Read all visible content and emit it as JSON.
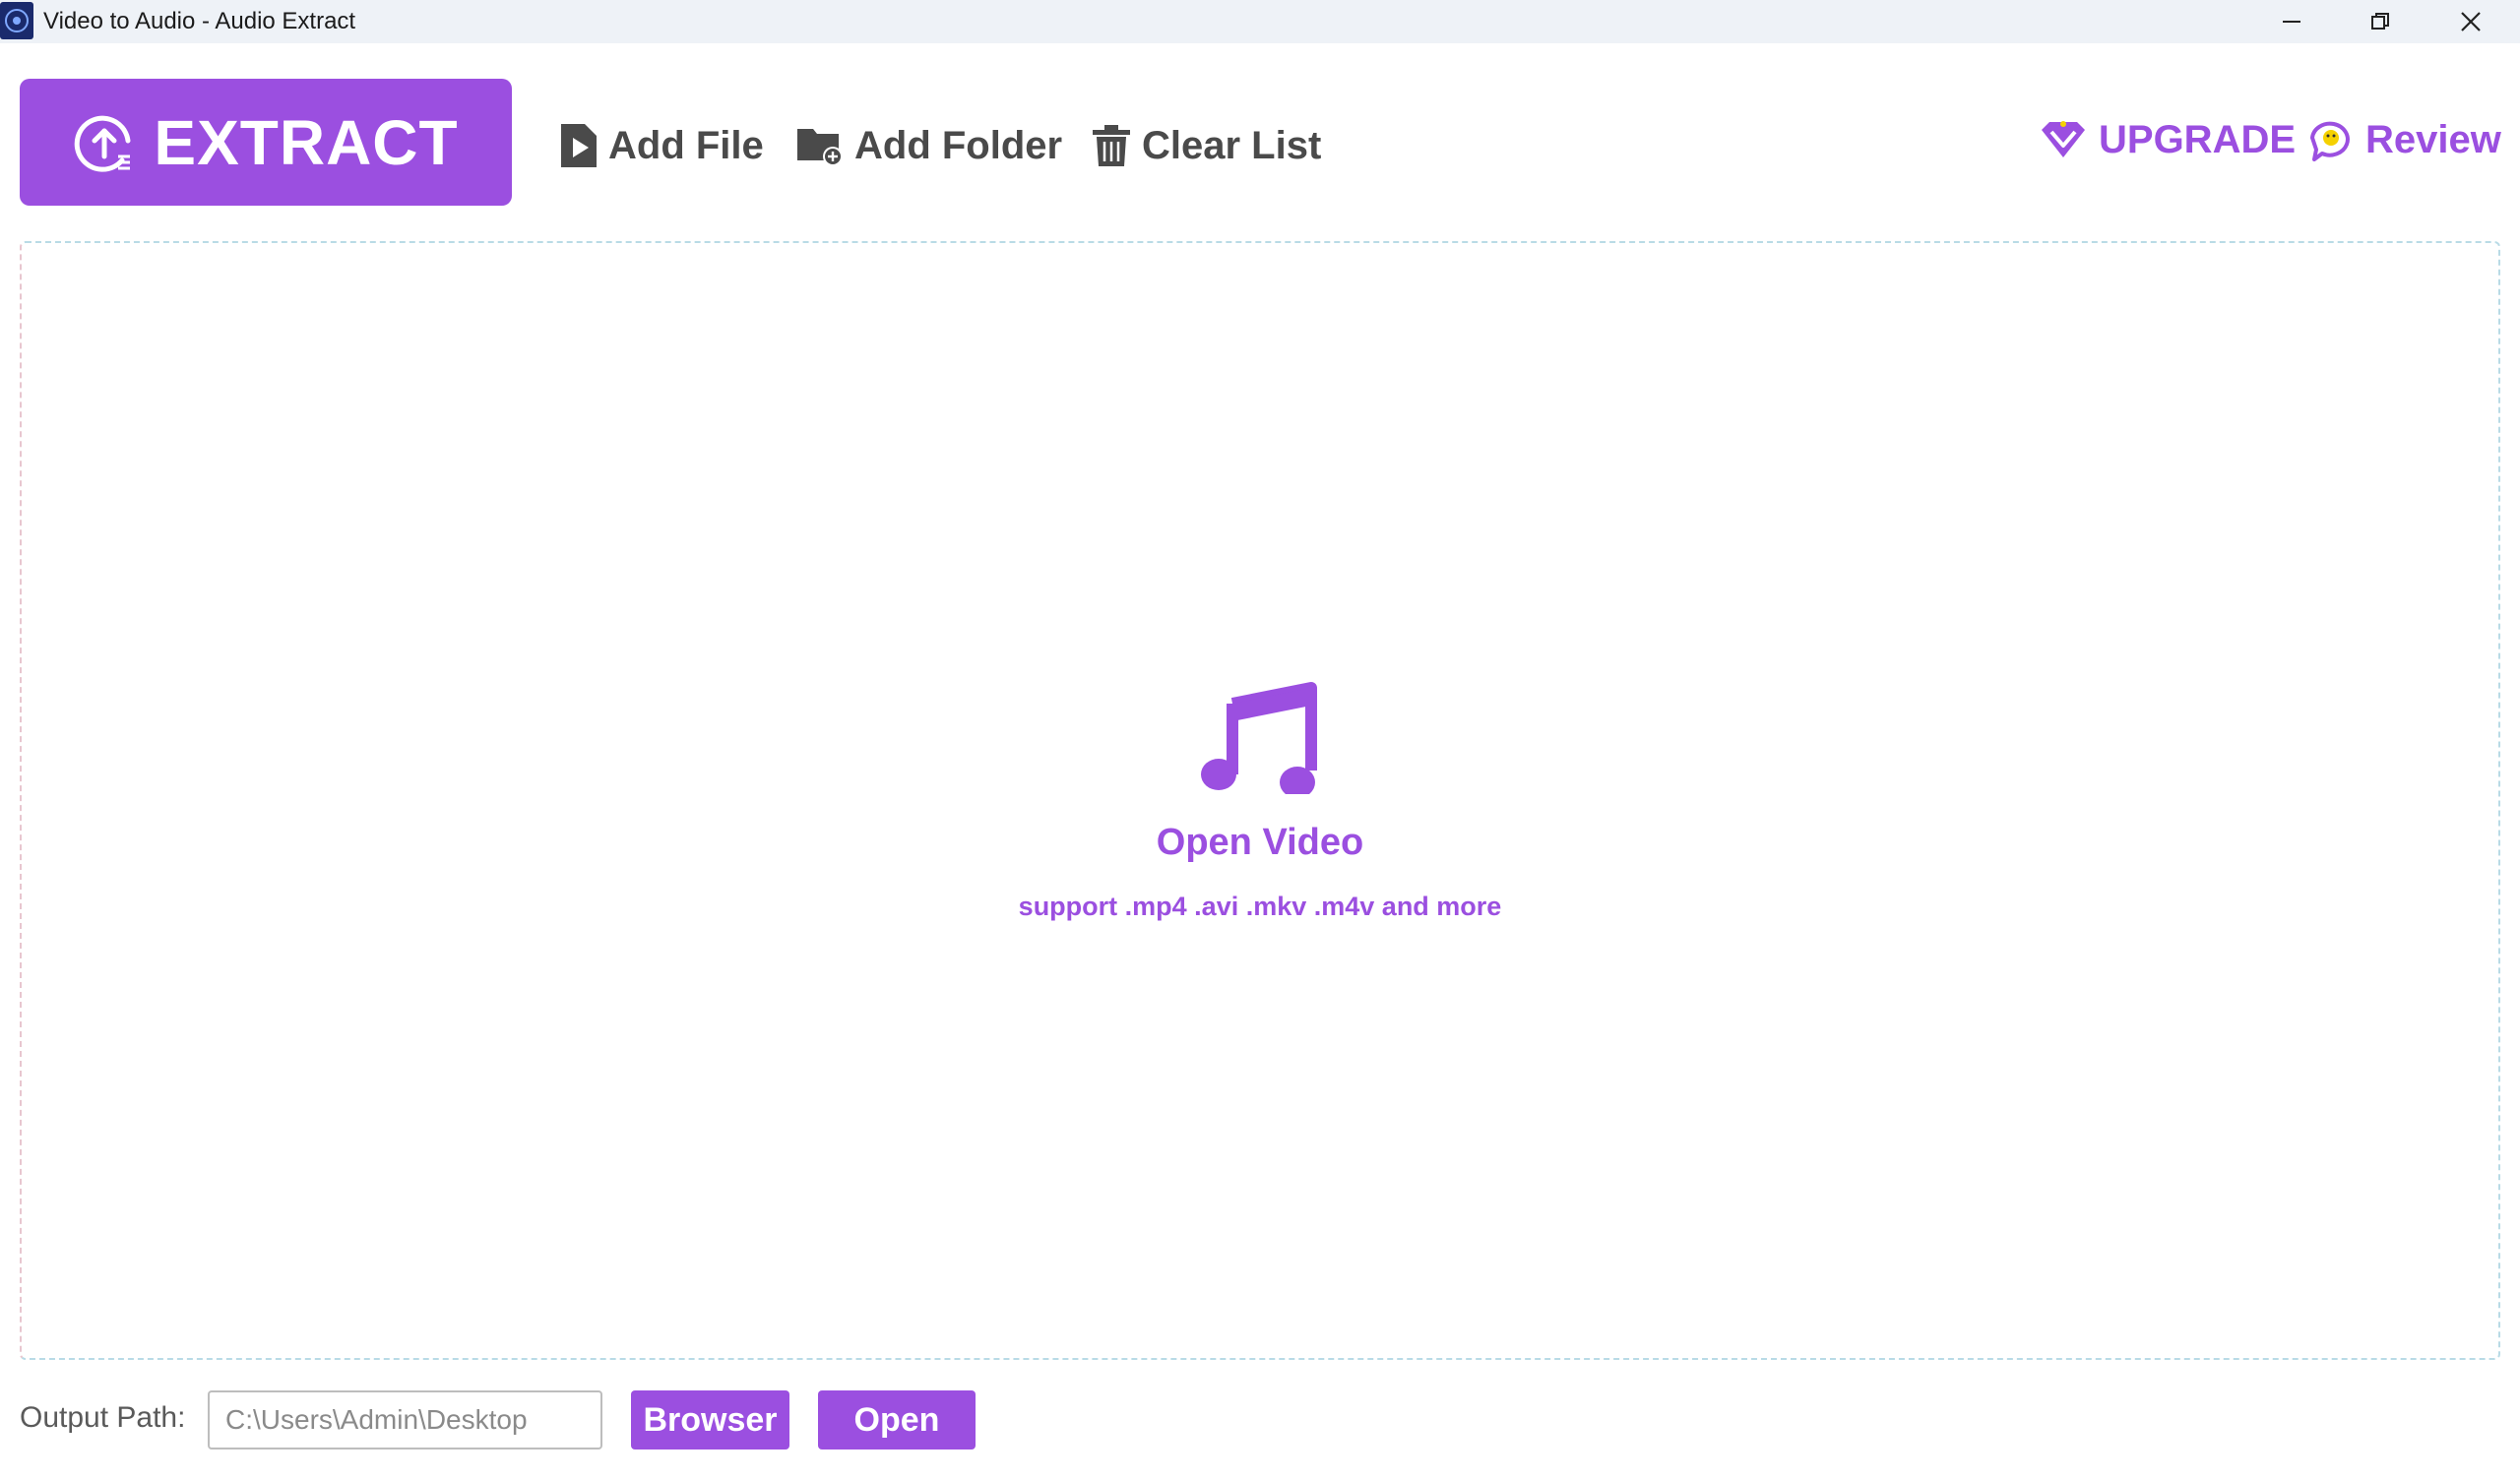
{
  "window": {
    "title": "Video to Audio - Audio Extract",
    "controls": [
      "minimize-icon",
      "restore-icon",
      "close-icon"
    ]
  },
  "toolbar": {
    "extract_label": "EXTRACT",
    "add_file_label": "Add File",
    "add_folder_label": "Add Folder",
    "clear_list_label": "Clear List",
    "upgrade_label": "UPGRADE",
    "review_label": "Review"
  },
  "dropzone": {
    "icon": "music-note-icon",
    "title": "Open Video",
    "subtitle": "support .mp4 .avi .mkv .m4v and more"
  },
  "output": {
    "label": "Output Path:",
    "placeholder": "C:\\Users\\Admin\\Desktop",
    "value": "",
    "browser_label": "Browser",
    "open_label": "Open"
  },
  "colors": {
    "accent": "#9b4fe0",
    "toolbar_text": "#4a4a4a",
    "titlebar_bg": "#eef2f7"
  }
}
